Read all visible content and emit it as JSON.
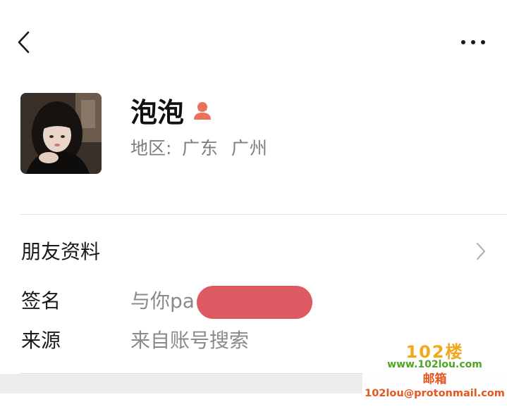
{
  "header": {
    "back_icon": "chevron-left-icon",
    "more_icon": "more-horizontal-icon"
  },
  "profile": {
    "name": "泡泡",
    "gender_icon": "female-user-icon",
    "gender_color": "#E8735A",
    "region_label": "地区:",
    "region_value": "广东  广州"
  },
  "friend_info": {
    "label": "朋友资料",
    "chevron_icon": "chevron-right-icon"
  },
  "details": {
    "signature_label": "签名",
    "signature_value": "与你pa",
    "source_label": "来源",
    "source_value": "来自账号搜索"
  },
  "watermark": {
    "logo": "102楼",
    "site": "www.102lou.com",
    "mail_label": "邮箱",
    "email": "102lou@protonmail.com"
  },
  "colors": {
    "redaction": "#DC5A61",
    "secondary_text": "#7D7D7D"
  }
}
